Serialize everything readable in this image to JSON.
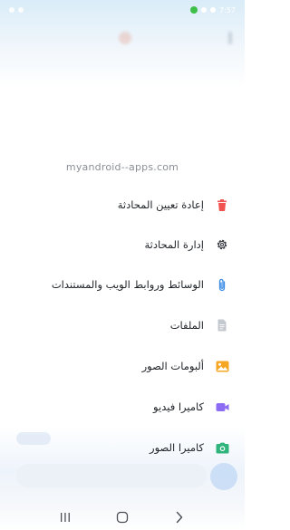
{
  "status_bar": {
    "time": "7:57"
  },
  "watermark": "myandroid--apps.com",
  "menu": {
    "items": [
      {
        "label": "إعادة تعيين المحادثة",
        "icon": "trash-icon",
        "color": "#f0524f"
      },
      {
        "label": "إدارة المحادثة",
        "icon": "gear-icon",
        "color": "#3a3f45"
      },
      {
        "label": "الوسائط وروابط الويب والمستندات",
        "icon": "paperclip-icon",
        "color": "#3c8ce7"
      },
      {
        "label": "الملفات",
        "icon": "document-icon",
        "color": "#b9bec6"
      },
      {
        "label": "ألبومات الصور",
        "icon": "image-icon",
        "color": "#f5a623"
      },
      {
        "label": "كاميرا فيديو",
        "icon": "video-camera-icon",
        "color": "#8c6cf2"
      },
      {
        "label": "كاميرا الصور",
        "icon": "camera-icon",
        "color": "#2fb47c"
      }
    ]
  },
  "nav": {
    "recents": "recents-icon",
    "home": "home-icon",
    "back": "back-icon"
  },
  "colors": {
    "accent": "#3c8ce7",
    "text": "#1f2328",
    "watermark": "#8a8f96"
  }
}
